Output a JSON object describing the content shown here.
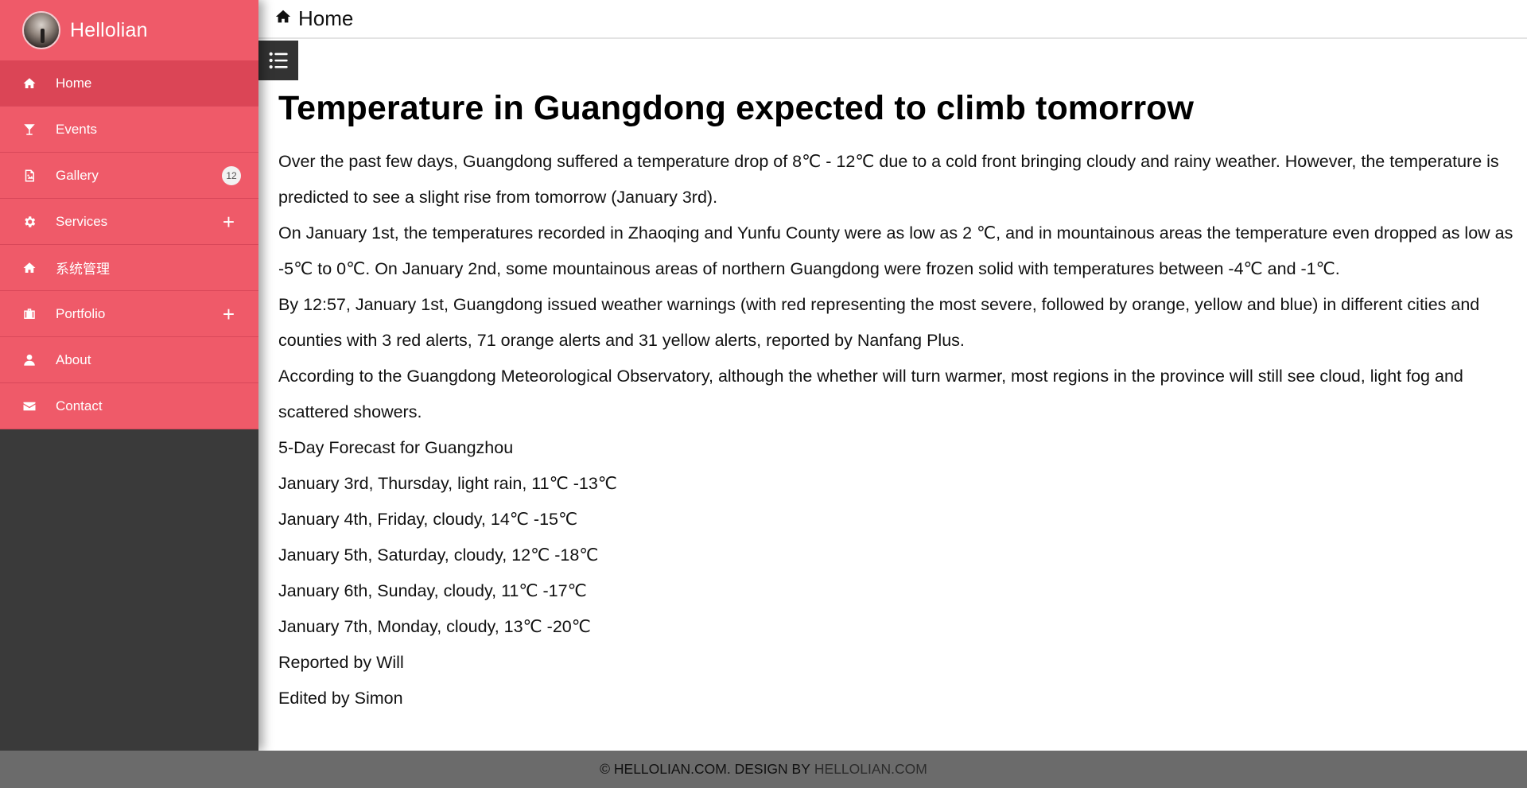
{
  "brand": {
    "name": "Hellolian"
  },
  "sidebar": {
    "items": [
      {
        "label": "Home",
        "icon": "home-icon",
        "active": true
      },
      {
        "label": "Events",
        "icon": "glass-icon"
      },
      {
        "label": "Gallery",
        "icon": "picture-icon",
        "badge": "12"
      },
      {
        "label": "Services",
        "icon": "gear-icon",
        "expand": "+"
      },
      {
        "label": "系统管理",
        "icon": "home-icon"
      },
      {
        "label": "Portfolio",
        "icon": "briefcase-icon",
        "expand": "+"
      },
      {
        "label": "About",
        "icon": "user-icon"
      },
      {
        "label": "Contact",
        "icon": "envelope-icon"
      }
    ]
  },
  "topbar": {
    "title": "Home"
  },
  "article": {
    "title": "Temperature in Guangdong expected to climb tomorrow",
    "paragraphs": [
      "Over the past few days, Guangdong suffered a temperature drop of 8℃ - 12℃ due to a cold front bringing cloudy and rainy weather. However, the temperature is predicted to see a slight rise from tomorrow (January 3rd).",
      "On January 1st, the temperatures recorded in Zhaoqing and Yunfu County were as low as 2 ℃, and in mountainous areas the temperature even dropped as low as -5℃ to 0℃. On January 2nd, some mountainous areas of northern Guangdong were frozen solid with temperatures between -4℃ and -1℃.",
      "By 12:57, January 1st, Guangdong issued weather warnings (with red representing the most severe, followed by orange, yellow and blue) in different cities and counties with 3 red alerts, 71 orange alerts and 31 yellow alerts, reported by Nanfang Plus.",
      "According to the Guangdong Meteorological Observatory, although the whether will turn warmer, most regions in the province will still see cloud, light fog and scattered showers.",
      "5-Day Forecast for Guangzhou",
      "January 3rd, Thursday, light rain, 11℃ -13℃",
      "January 4th, Friday, cloudy, 14℃ -15℃",
      "January 5th, Saturday, cloudy, 12℃ -18℃",
      "January 6th, Sunday, cloudy, 11℃ -17℃",
      "January 7th, Monday, cloudy, 13℃ -20℃",
      "Reported by Will",
      "Edited by Simon"
    ]
  },
  "footer": {
    "text": "© HELLOLIAN.COM. DESIGN BY",
    "link": "HELLOLIAN.COM"
  },
  "colors": {
    "accent": "#ef5a69",
    "accent_active": "#db4556",
    "sidebar_bg": "#3a3a3a",
    "footer_bg": "#6b6b6b"
  }
}
